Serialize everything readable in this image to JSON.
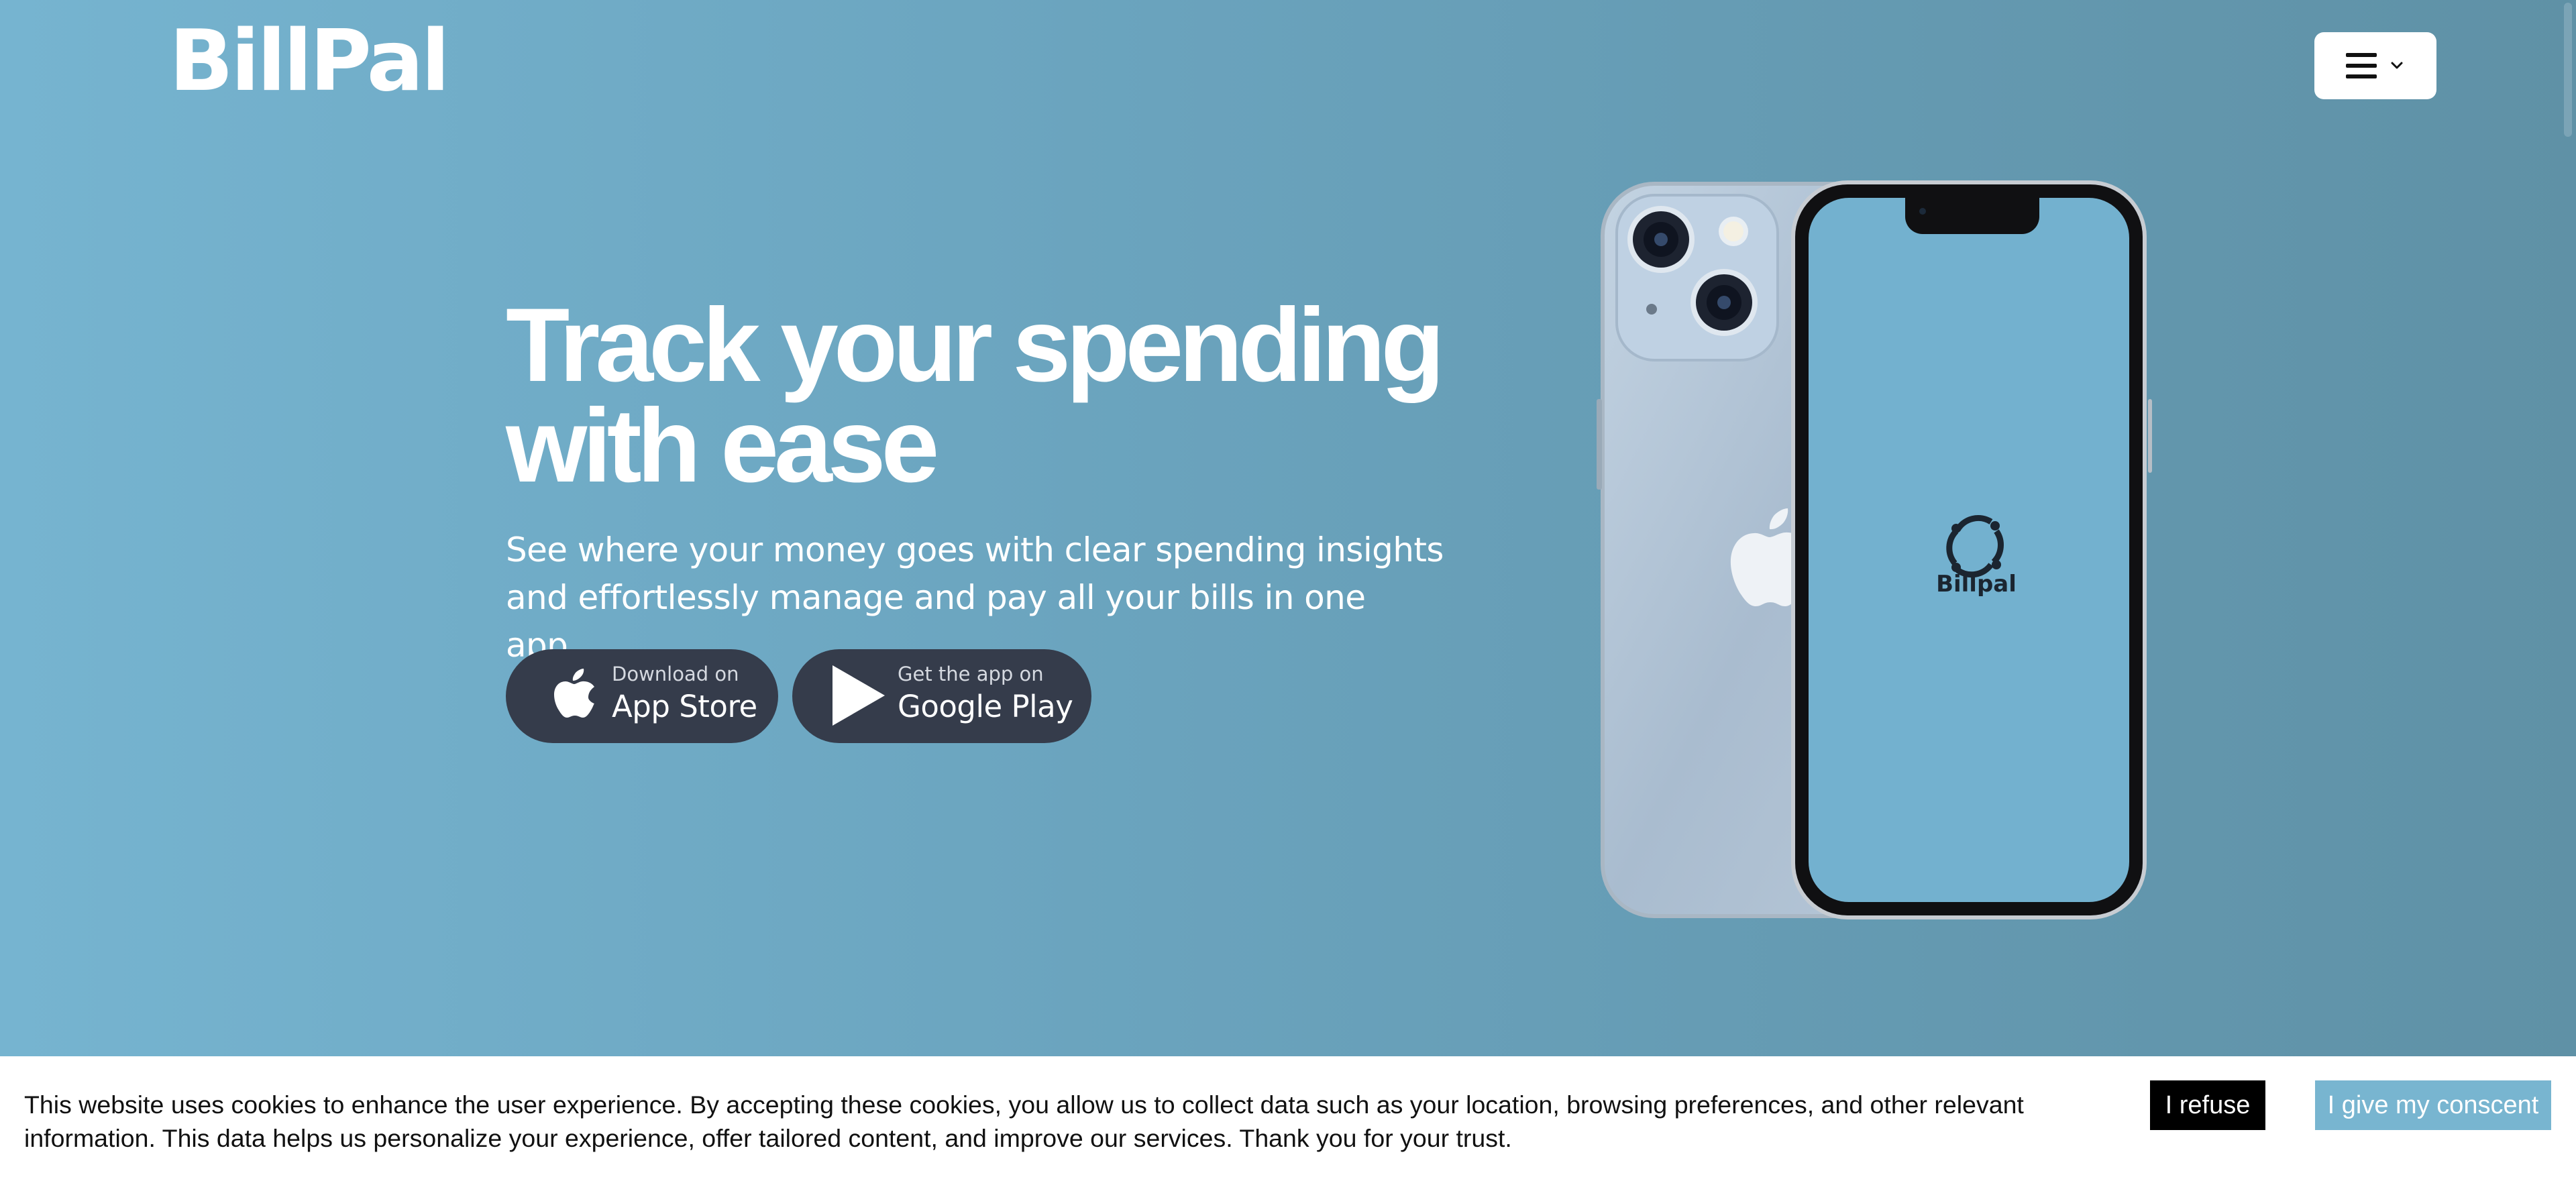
{
  "header": {
    "logo": "BillPal",
    "menu_icon": "hamburger-icon",
    "menu_chevron_icon": "chevron-down-icon"
  },
  "hero": {
    "title_line1": "Track your spending",
    "title_line2": "with ease",
    "subtitle_line1": "See where your money goes with clear spending insights",
    "subtitle_line2": "and effortlessly manage and pay all your bills in one app."
  },
  "store_buttons": {
    "app_store": {
      "small": "Download on",
      "big": "App Store",
      "icon": "apple-icon"
    },
    "google_play": {
      "small": "Get the app on",
      "big": "Google Play",
      "icon": "play-icon"
    }
  },
  "phone": {
    "screen_app_name": "Billpal",
    "screen_color": "#73b1cf"
  },
  "cookie_banner": {
    "text": "This website uses cookies to enhance the user experience. By accepting these cookies, you allow us to collect data such as your location, browsing preferences, and other relevant information. This data helps us personalize your experience, offer tailored content, and improve our services. Thank you for your trust.",
    "refuse_label": "I refuse",
    "consent_label": "I give my conscent"
  },
  "colors": {
    "bg_left": "#76b4d0",
    "bg_right": "#5f91a6",
    "store_button": "#353c4b",
    "consent_button": "#78b5d0"
  }
}
